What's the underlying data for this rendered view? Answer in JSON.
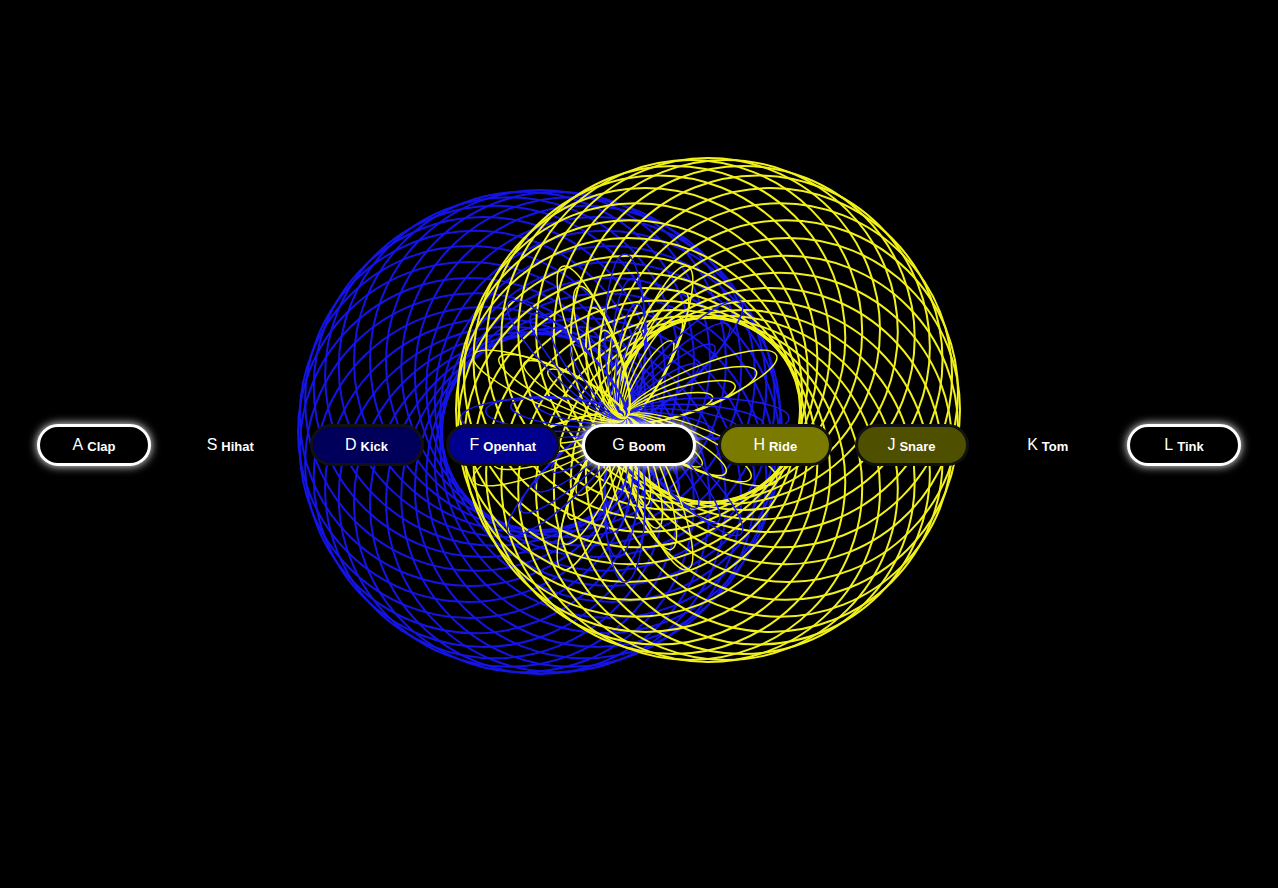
{
  "keys": [
    {
      "key": "A",
      "sound": "Clap",
      "playing": true,
      "outlined": true,
      "color": "#000000"
    },
    {
      "key": "S",
      "sound": "Hihat",
      "playing": false,
      "outlined": false,
      "color": "#000000"
    },
    {
      "key": "D",
      "sound": "Kick",
      "playing": false,
      "outlined": true,
      "color": "#00005a"
    },
    {
      "key": "F",
      "sound": "Openhat",
      "playing": false,
      "outlined": true,
      "color": "#00008c"
    },
    {
      "key": "G",
      "sound": "Boom",
      "playing": true,
      "outlined": true,
      "color": "#000000"
    },
    {
      "key": "H",
      "sound": "Ride",
      "playing": false,
      "outlined": true,
      "color": "#7a7a00"
    },
    {
      "key": "J",
      "sound": "Snare",
      "playing": false,
      "outlined": true,
      "color": "#4f4f00"
    },
    {
      "key": "K",
      "sound": "Tom",
      "playing": false,
      "outlined": false,
      "color": "#000000"
    },
    {
      "key": "L",
      "sound": "Tink",
      "playing": true,
      "outlined": true,
      "color": "#000000"
    }
  ]
}
